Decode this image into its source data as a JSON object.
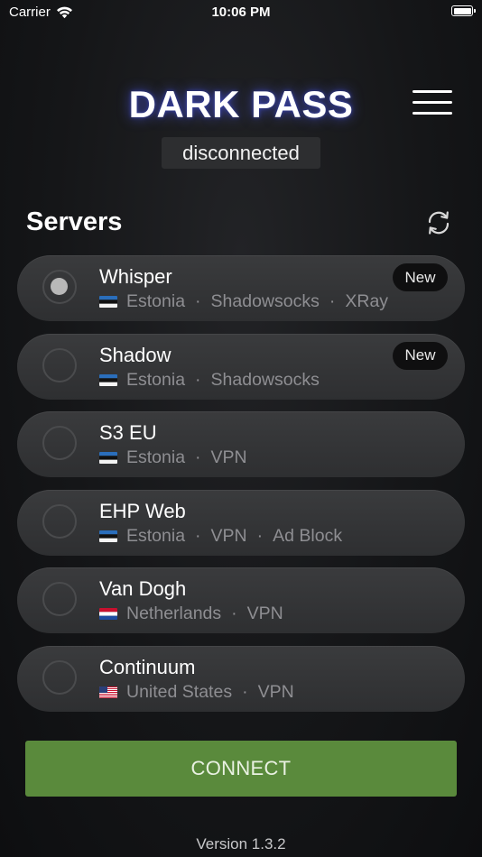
{
  "status_bar": {
    "carrier": "Carrier",
    "time": "10:06 PM",
    "icons": [
      "wifi-icon",
      "battery-icon"
    ]
  },
  "header": {
    "brand": "DARK PASS",
    "status": "disconnected",
    "menu_icon": "hamburger-menu-icon"
  },
  "servers": {
    "title": "Servers",
    "refresh_icon": "refresh-icon",
    "items": [
      {
        "name": "Whisper",
        "country": "Estonia",
        "flag": "estonia-flag-icon",
        "tags": [
          "Shadowsocks",
          "XRay"
        ],
        "badge": "New",
        "selected": true
      },
      {
        "name": "Shadow",
        "country": "Estonia",
        "flag": "estonia-flag-icon",
        "tags": [
          "Shadowsocks"
        ],
        "badge": "New",
        "selected": false
      },
      {
        "name": "S3 EU",
        "country": "Estonia",
        "flag": "estonia-flag-icon",
        "tags": [
          "VPN"
        ],
        "badge": "",
        "selected": false
      },
      {
        "name": "EHP Web",
        "country": "Estonia",
        "flag": "estonia-flag-icon",
        "tags": [
          "VPN",
          "Ad Block"
        ],
        "badge": "",
        "selected": false
      },
      {
        "name": "Van Dogh",
        "country": "Netherlands",
        "flag": "netherlands-flag-icon",
        "tags": [
          "VPN"
        ],
        "badge": "",
        "selected": false
      },
      {
        "name": "Continuum",
        "country": "United States",
        "flag": "united-states-flag-icon",
        "tags": [
          "VPN"
        ],
        "badge": "",
        "selected": false
      }
    ]
  },
  "connect_label": "CONNECT",
  "version": "Version 1.3.2",
  "colors": {
    "connect_button": "#5a8a3c",
    "row_background": "#333436",
    "secondary_text": "#8e8e92",
    "brand_glow": "#4650c8"
  }
}
